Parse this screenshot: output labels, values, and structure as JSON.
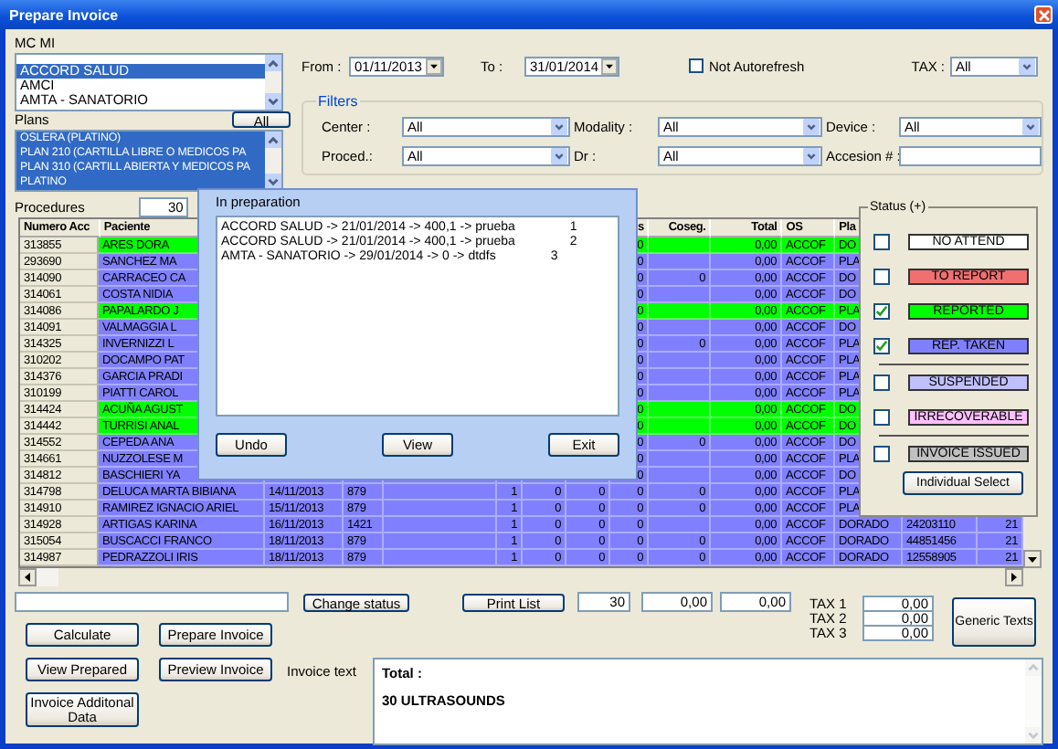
{
  "window": {
    "title": "Prepare Invoice"
  },
  "mcmi": {
    "label": "MC MI",
    "items": [
      {
        "label": "ACCORD SALUD",
        "selected": true
      },
      {
        "label": "AMCI",
        "selected": false
      },
      {
        "label": "AMTA - SANATORIO",
        "selected": false
      }
    ]
  },
  "plans": {
    "label": "Plans",
    "all_button": "All",
    "items": [
      {
        "label": "OSLERA (PLATINO)",
        "selected": true
      },
      {
        "label": "PLAN 210 (CARTILLA LIBRE O MEDICOS PA",
        "selected": true
      },
      {
        "label": "PLAN 310 (CARTILL ABIERTA Y MEDICOS PA",
        "selected": true
      },
      {
        "label": "PLATINO",
        "selected": true
      }
    ]
  },
  "dates": {
    "from_label": "From :",
    "from": "01/11/2013",
    "to_label": "To :",
    "to": "31/01/2014"
  },
  "not_autorefresh": {
    "label": "Not Autorefresh",
    "checked": false
  },
  "tax": {
    "label": "TAX :",
    "value": "All"
  },
  "filters": {
    "title": "Filters",
    "fields": [
      {
        "label": "Center :",
        "value": "All",
        "kind": "select"
      },
      {
        "label": "Modality :",
        "value": "All",
        "kind": "select"
      },
      {
        "label": "Device :",
        "value": "All",
        "kind": "select"
      },
      {
        "label": "Proced.:",
        "value": "All",
        "kind": "select"
      },
      {
        "label": "Dr :",
        "value": "All",
        "kind": "select"
      },
      {
        "label": "Accesion # :",
        "kind": "input"
      }
    ]
  },
  "procedures": {
    "label": "Procedures",
    "value": "30"
  },
  "table": {
    "headers": {
      "acc": "Numero Acc",
      "patient": "Paciente",
      "z3": "s",
      "coseg": "Coseg.",
      "total": "Total",
      "os": "OS",
      "plan": "Pla"
    },
    "rows": [
      {
        "acc": "313855",
        "patient": "ARES DORA",
        "z3": "0",
        "total": "0,00",
        "os": "ACCOF",
        "plan": "DO",
        "color": "#00ff00"
      },
      {
        "acc": "293690",
        "patient": "SANCHEZ MA",
        "z3": "0",
        "total": "0,00",
        "os": "ACCOF",
        "plan": "PLA",
        "color": "#8080ff"
      },
      {
        "acc": "314090",
        "patient": "CARRACEO CA",
        "z3": "0",
        "coseg": "0",
        "total": "0,00",
        "os": "ACCOF",
        "plan": "DO",
        "color": "#8080ff"
      },
      {
        "acc": "314061",
        "patient": "COSTA NIDIA",
        "z3": "0",
        "total": "0,00",
        "os": "ACCOF",
        "plan": "DO",
        "color": "#8080ff"
      },
      {
        "acc": "314086",
        "patient": "PAPALARDO J",
        "z3": "0",
        "total": "0,00",
        "os": "ACCOF",
        "plan": "PLA",
        "color": "#00ff00"
      },
      {
        "acc": "314091",
        "patient": "VALMAGGIA L",
        "z3": "0",
        "total": "0,00",
        "os": "ACCOF",
        "plan": "DO",
        "color": "#8080ff"
      },
      {
        "acc": "314325",
        "patient": "INVERNIZZI L",
        "z3": "0",
        "coseg": "0",
        "total": "0,00",
        "os": "ACCOF",
        "plan": "PLA",
        "color": "#8080ff"
      },
      {
        "acc": "310202",
        "patient": "DOCAMPO PAT",
        "z3": "0",
        "total": "0,00",
        "os": "ACCOF",
        "plan": "PLA",
        "color": "#8080ff"
      },
      {
        "acc": "314376",
        "patient": "GARCIA PRADI",
        "z3": "0",
        "total": "0,00",
        "os": "ACCOF",
        "plan": "PLA",
        "color": "#8080ff"
      },
      {
        "acc": "310199",
        "patient": "PIATTI CAROL",
        "z3": "0",
        "total": "0,00",
        "os": "ACCOF",
        "plan": "PLA",
        "color": "#8080ff"
      },
      {
        "acc": "314424",
        "patient": "ACUÑA AGUST",
        "z3": "0",
        "total": "0,00",
        "os": "ACCOF",
        "plan": "DO",
        "color": "#00ff00"
      },
      {
        "acc": "314442",
        "patient": "TURRISI ANAL",
        "z3": "0",
        "total": "0,00",
        "os": "ACCOF",
        "plan": "DO",
        "color": "#00ff00"
      },
      {
        "acc": "314552",
        "patient": "CEPEDA ANA",
        "z3": "0",
        "coseg": "0",
        "total": "0,00",
        "os": "ACCOF",
        "plan": "DO",
        "color": "#8080ff"
      },
      {
        "acc": "314661",
        "patient": "NUZZOLESE M",
        "z3": "0",
        "total": "0,00",
        "os": "ACCOF",
        "plan": "PLA",
        "color": "#8080ff"
      },
      {
        "acc": "314812",
        "patient": "BASCHIERI YA",
        "z3": "0",
        "total": "0,00",
        "os": "ACCOF",
        "plan": "DO",
        "color": "#8080ff"
      },
      {
        "acc": "314798",
        "patient": "DELUCA MARTA BIBIANA",
        "date": "14/11/2013",
        "code": "879",
        "qty": "1",
        "z1": "0",
        "z2": "0",
        "z3": "0",
        "coseg": "0",
        "total": "0,00",
        "os": "ACCOF",
        "plan": "PLA",
        "color": "#8080ff"
      },
      {
        "acc": "314910",
        "patient": "RAMIREZ IGNACIO ARIEL",
        "date": "15/11/2013",
        "code": "879",
        "qty": "1",
        "z1": "0",
        "z2": "0",
        "z3": "0",
        "coseg": "0",
        "total": "0,00",
        "os": "ACCOF",
        "plan": "PLA",
        "color": "#8080ff"
      },
      {
        "acc": "314928",
        "patient": "ARTIGAS KARINA",
        "date": "16/11/2013",
        "code": "1421",
        "qty": "1",
        "z1": "0",
        "z2": "0",
        "z3": "0",
        "total": "0,00",
        "os": "ACCOF",
        "plan": "DORADO",
        "doc": "24203110",
        "last": "21",
        "color": "#8080ff"
      },
      {
        "acc": "315054",
        "patient": "BUSCACCI FRANCO",
        "date": "18/11/2013",
        "code": "879",
        "qty": "1",
        "z1": "0",
        "z2": "0",
        "z3": "0",
        "coseg": "0",
        "total": "0,00",
        "os": "ACCOF",
        "plan": "DORADO",
        "doc": "44851456",
        "last": "21",
        "color": "#8080ff"
      },
      {
        "acc": "314987",
        "patient": "PEDRAZZOLI IRIS",
        "date": "18/11/2013",
        "code": "879",
        "qty": "1",
        "z1": "0",
        "z2": "0",
        "z3": "0",
        "coseg": "0",
        "total": "0,00",
        "os": "ACCOF",
        "plan": "DORADO",
        "doc": "12558905",
        "last": "21",
        "color": "#8080ff"
      }
    ]
  },
  "in_preparation": {
    "title": "In preparation",
    "entries": [
      {
        "text": "ACCORD SALUD -> 21/01/2014 -> 400,1 -> prueba",
        "count": "1"
      },
      {
        "text": "ACCORD SALUD -> 21/01/2014 -> 400,1 -> prueba",
        "count": "2"
      },
      {
        "text": "AMTA - SANATORIO -> 29/01/2014 -> 0 -> dtdfs",
        "count": "3"
      }
    ],
    "buttons": [
      "Undo",
      "View",
      "Exit"
    ]
  },
  "status": {
    "title": "Status (+)",
    "groups": [
      [
        {
          "label": "NO ATTEND",
          "checked": false,
          "color": "#ffffff"
        },
        {
          "label": "TO REPORT",
          "checked": false,
          "color": "#f07070"
        },
        {
          "label": "REPORTED",
          "checked": true,
          "color": "#00ff00"
        },
        {
          "label": "REP. TAKEN",
          "checked": true,
          "color": "#8080ff"
        }
      ],
      [
        {
          "label": "SUSPENDED",
          "checked": false,
          "color": "#c0c0ff"
        },
        {
          "label": "IRRECOVERABLE",
          "checked": false,
          "color": "#ffc0ff"
        }
      ],
      [
        {
          "label": "INVOICE ISSUED",
          "checked": false,
          "color": "#c0c0c0"
        }
      ]
    ],
    "button": "Individual Select"
  },
  "footer": {
    "change_status": "Change status",
    "print_list": "Print List",
    "count": "30",
    "amount_1": "0,00",
    "amount_2": "0,00",
    "taxes": [
      {
        "label": "TAX 1",
        "value": "0,00"
      },
      {
        "label": "TAX 2",
        "value": "0,00"
      },
      {
        "label": "TAX 3",
        "value": "0,00"
      }
    ],
    "generic_texts": "Generic Texts",
    "buttons": [
      "Calculate",
      "Prepare Invoice",
      "View Prepared",
      "Preview Invoice",
      "Invoice Additonal Data"
    ],
    "invoice_text": {
      "label": "Invoice text",
      "lines": [
        "Total :",
        "30 ULTRASOUNDS"
      ]
    }
  }
}
